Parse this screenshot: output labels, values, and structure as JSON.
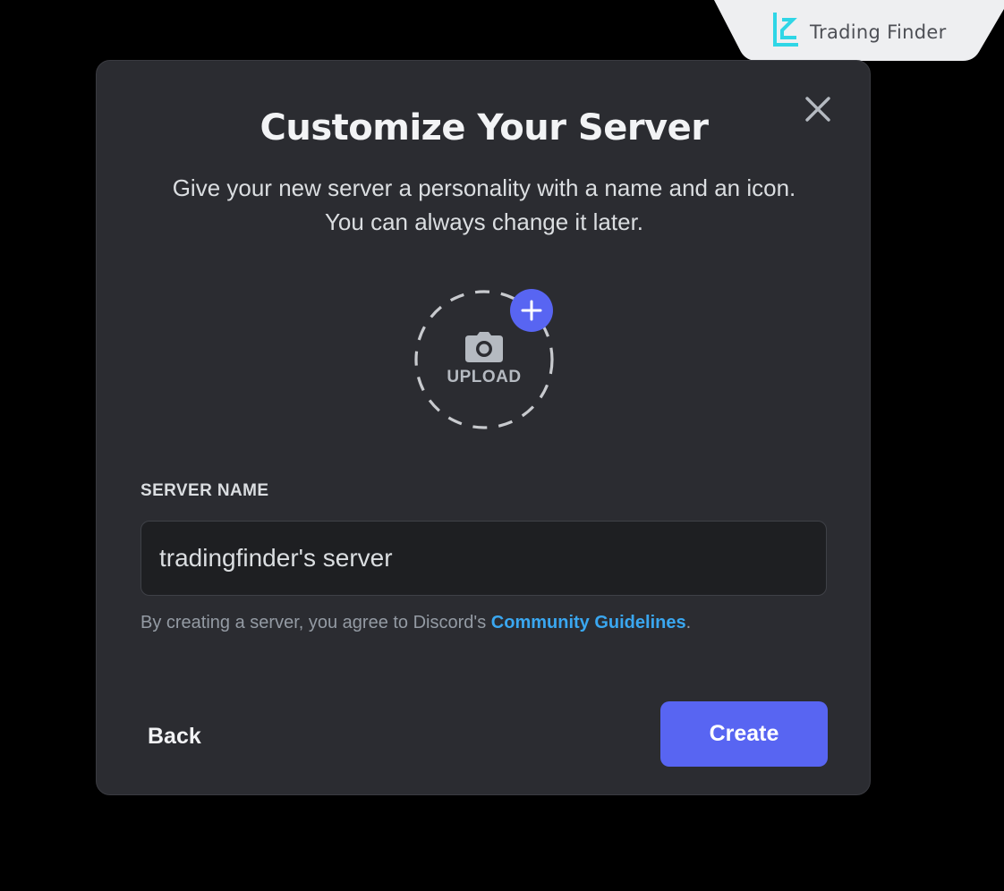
{
  "watermark": {
    "brand_text": "Trading Finder",
    "logo_icon": "trading-finder-logo"
  },
  "modal": {
    "title": "Customize Your Server",
    "subtitle": "Give your new server a personality with a name and an icon. You can always change it later.",
    "close_icon": "close-icon",
    "upload": {
      "label": "UPLOAD",
      "camera_icon": "camera-icon",
      "plus_icon": "plus-icon"
    },
    "server_name": {
      "label": "SERVER NAME",
      "value": "tradingfinder's server"
    },
    "terms": {
      "prefix": "By creating a server, you agree to Discord's ",
      "link": "Community Guidelines",
      "suffix": "."
    },
    "buttons": {
      "back": "Back",
      "create": "Create"
    }
  },
  "colors": {
    "background": "#000000",
    "modal": "#2b2c31",
    "input": "#1e1f22",
    "accent": "#5865f2",
    "link": "#3aa7f0"
  }
}
